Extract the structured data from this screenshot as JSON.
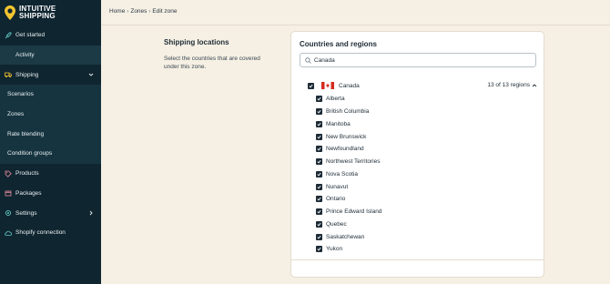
{
  "brand": {
    "line1": "INTUITIVE",
    "line2": "SHIPPING",
    "accent": "#f4c430"
  },
  "sidebar": {
    "items": [
      {
        "label": "Get started",
        "icon": "rocket-icon"
      },
      {
        "label": "Activity",
        "icon": "",
        "active": true
      },
      {
        "label": "Shipping",
        "icon": "truck-icon",
        "expanded": true
      },
      {
        "label": "Scenarios",
        "sub": true
      },
      {
        "label": "Zones",
        "sub": true
      },
      {
        "label": "Rate blending",
        "sub": true
      },
      {
        "label": "Condition groups",
        "sub": true
      },
      {
        "label": "Products",
        "icon": "tag-icon"
      },
      {
        "label": "Packages",
        "icon": "box-icon"
      },
      {
        "label": "Settings",
        "icon": "gear-icon",
        "chevron": "right"
      },
      {
        "label": "Shopify connection",
        "icon": "cloud-icon"
      }
    ]
  },
  "breadcrumb": {
    "items": [
      "Home",
      "Zones",
      "Edit zone"
    ]
  },
  "section": {
    "title": "Shipping locations",
    "description": "Select the countries that are covered under this zone."
  },
  "card": {
    "title": "Countries and regions",
    "search": {
      "value": "Canada"
    },
    "country": {
      "name": "Canada",
      "checked": true,
      "regions_summary": "13 of 13 regions"
    },
    "regions": [
      "Alberta",
      "British Columbia",
      "Manitoba",
      "New Brunswick",
      "Newfoundland",
      "Northwest Territories",
      "Nova Scotia",
      "Nunavut",
      "Ontario",
      "Prince Edward Island",
      "Quebec",
      "Saskatchewan",
      "Yukon"
    ]
  }
}
